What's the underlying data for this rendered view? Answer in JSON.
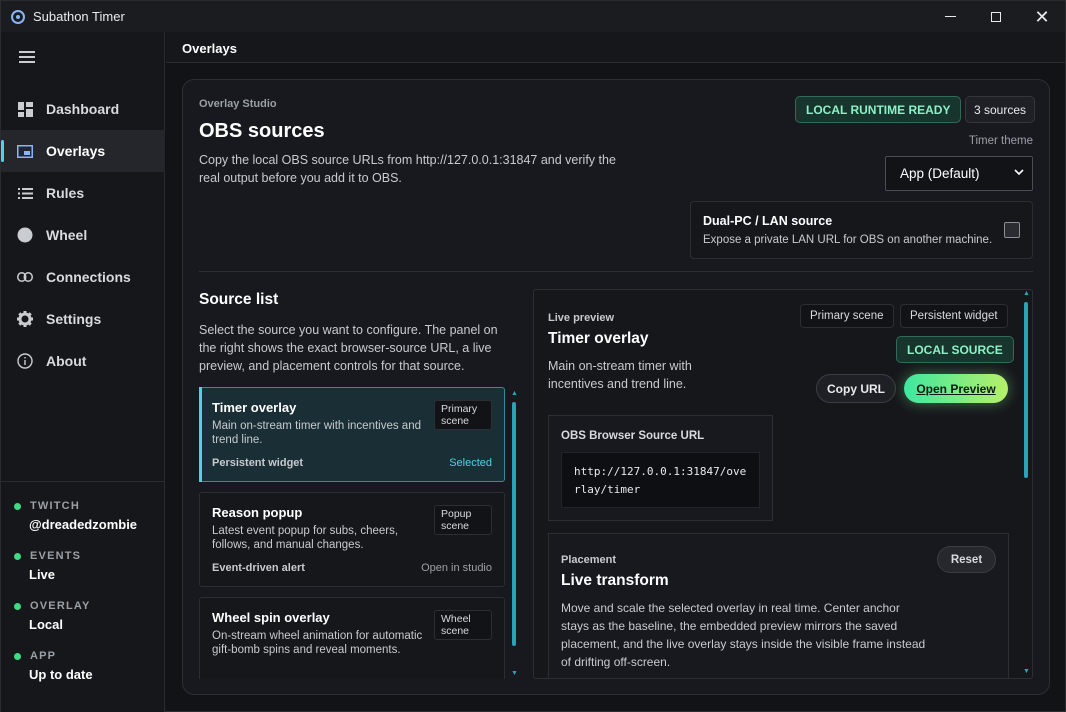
{
  "window": {
    "title": "Subathon Timer"
  },
  "sidebar": {
    "items": [
      {
        "label": "Dashboard",
        "icon": "dashboard-icon"
      },
      {
        "label": "Overlays",
        "icon": "overlay-icon",
        "active": true
      },
      {
        "label": "Rules",
        "icon": "list-icon"
      },
      {
        "label": "Wheel",
        "icon": "wheel-icon"
      },
      {
        "label": "Connections",
        "icon": "link-icon"
      },
      {
        "label": "Settings",
        "icon": "gear-icon"
      },
      {
        "label": "About",
        "icon": "info-icon"
      }
    ],
    "status": [
      {
        "key": "TWITCH",
        "value": "@dreadedzombie"
      },
      {
        "key": "EVENTS",
        "value": "Live"
      },
      {
        "key": "OVERLAY",
        "value": "Local"
      },
      {
        "key": "APP",
        "value": "Up to date"
      }
    ],
    "status_color": "#3ddc84"
  },
  "header": {
    "title": "Overlays"
  },
  "studio": {
    "eyebrow": "Overlay Studio",
    "title": "OBS sources",
    "lead": "Copy the local OBS source URLs from http://127.0.0.1:31847 and verify the real output before you add it to OBS.",
    "runtime_badge": "LOCAL RUNTIME READY",
    "source_count": "3 sources",
    "theme_label": "Timer theme",
    "theme_value": "App (Default)",
    "lan": {
      "title": "Dual-PC / LAN source",
      "desc": "Expose a private LAN URL for OBS on another machine.",
      "checked": false
    }
  },
  "source_list": {
    "title": "Source list",
    "desc": "Select the source you want to configure. The panel on the right shows the exact browser-source URL, a live preview, and placement controls for that source.",
    "items": [
      {
        "name": "Timer overlay",
        "desc": "Main on-stream timer with incentives and trend line.",
        "tag": "Primary scene",
        "foot": "Persistent widget",
        "state": "Selected"
      },
      {
        "name": "Reason popup",
        "desc": "Latest event popup for subs, cheers, follows, and manual changes.",
        "tag": "Popup scene",
        "foot": "Event-driven alert",
        "state": "Open in studio"
      },
      {
        "name": "Wheel spin overlay",
        "desc": "On-stream wheel animation for automatic gift-bomb spins and reveal moments.",
        "tag": "Wheel scene",
        "foot": "",
        "state": ""
      }
    ]
  },
  "preview": {
    "eyebrow": "Live preview",
    "title": "Timer overlay",
    "desc": "Main on-stream timer with incentives and trend line.",
    "chips": [
      "Primary scene",
      "Persistent widget"
    ],
    "local_badge": "LOCAL SOURCE",
    "copy_label": "Copy URL",
    "open_label": "Open Preview",
    "url_label": "OBS Browser Source URL",
    "url": "http://127.0.0.1:31847/overlay/timer",
    "placement": {
      "eyebrow": "Placement",
      "title": "Live transform",
      "desc": "Move and scale the selected overlay in real time. Center anchor stays as the baseline, the embedded preview mirrors the saved placement, and the live overlay stays inside the visible frame instead of drifting off-screen.",
      "reset_label": "Reset"
    }
  },
  "colors": {
    "accent": "#4fd1e8",
    "ready_text": "#8cf0c8",
    "open_gradient_start": "#3ee8a0",
    "open_gradient_end": "#b6f06a"
  }
}
